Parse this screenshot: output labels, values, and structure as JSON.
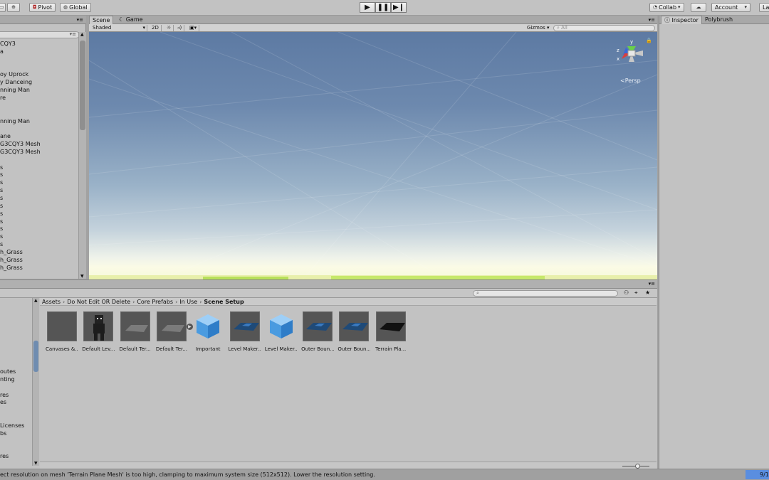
{
  "toolbar": {
    "pivot_label": "Pivot",
    "global_label": "Global",
    "play_icon": "play-icon",
    "pause_icon": "pause-icon",
    "step_icon": "step-icon",
    "collab_label": "Collab",
    "account_label": "Account",
    "layers_label": "La"
  },
  "scene": {
    "tabs": [
      {
        "label": "Scene"
      },
      {
        "label": "Game"
      }
    ],
    "shading_mode": "Shaded",
    "mode_2d": "2D",
    "gizmos_label": "Gizmos",
    "search_placeholder": "All",
    "persp_label": "Persp",
    "gizmo_axes": {
      "x": "x",
      "y": "y",
      "z": "z"
    }
  },
  "inspector": {
    "tabs": [
      {
        "label": "Inspector"
      },
      {
        "label": "Polybrush"
      }
    ]
  },
  "hierarchy": {
    "items": [
      {
        "label": "CQY3"
      },
      {
        "label": "a"
      },
      {
        "label": ""
      },
      {
        "label": ""
      },
      {
        "label": "oy Uprock"
      },
      {
        "label": "y Danceing"
      },
      {
        "label": "nning Man"
      },
      {
        "label": "re"
      },
      {
        "label": ""
      },
      {
        "label": ""
      },
      {
        "label": "nning Man"
      },
      {
        "label": ""
      },
      {
        "label": "ane"
      },
      {
        "label": "G3CQY3 Mesh"
      },
      {
        "label": "G3CQY3 Mesh"
      },
      {
        "label": ""
      },
      {
        "label": "s"
      },
      {
        "label": "s"
      },
      {
        "label": "s"
      },
      {
        "label": "s"
      },
      {
        "label": "s"
      },
      {
        "label": "s"
      },
      {
        "label": "s"
      },
      {
        "label": "s"
      },
      {
        "label": "s"
      },
      {
        "label": "s"
      },
      {
        "label": "s"
      },
      {
        "label": "h_Grass"
      },
      {
        "label": "h_Grass"
      },
      {
        "label": "h_Grass"
      }
    ]
  },
  "project": {
    "breadcrumb": [
      "Assets",
      "Do Not Edit OR Delete",
      "Core Prefabs",
      "In Use",
      "Scene Setup"
    ],
    "tree_items": [
      {
        "label": "outes",
        "row": 9
      },
      {
        "label": "nting",
        "row": 10
      },
      {
        "label": "res",
        "row": 12
      },
      {
        "label": "es",
        "row": 13
      },
      {
        "label": " Licenses",
        "row": 16
      },
      {
        "label": "bs",
        "row": 17
      },
      {
        "label": "res",
        "row": 20
      }
    ],
    "assets": [
      {
        "label": "Canvases &...",
        "kind": "dark"
      },
      {
        "label": "Default Lev...",
        "kind": "figure"
      },
      {
        "label": "Default Ter...",
        "kind": "plane-grey"
      },
      {
        "label": "Default Ter...",
        "kind": "plane-grey"
      },
      {
        "label": "Important",
        "kind": "cube"
      },
      {
        "label": "Level Maker...",
        "kind": "plane-blue"
      },
      {
        "label": "Level Maker...",
        "kind": "cube"
      },
      {
        "label": "Outer Boun...",
        "kind": "plane-blue"
      },
      {
        "label": "Outer Boun...",
        "kind": "plane-blue"
      },
      {
        "label": "Terrain Pla...",
        "kind": "plane-black"
      }
    ]
  },
  "status": {
    "message": "ect resolution on mesh 'Terrain Plane Mesh' is too high, clamping to maximum system size (512x512). Lower the resolution setting.",
    "right_badge": "9/1"
  },
  "colors": {
    "sky_top": "#5d7aa3",
    "horizon": "#fbfbe6",
    "ground_green": "#b8e05a",
    "cube_blue": "#4a9be0"
  }
}
